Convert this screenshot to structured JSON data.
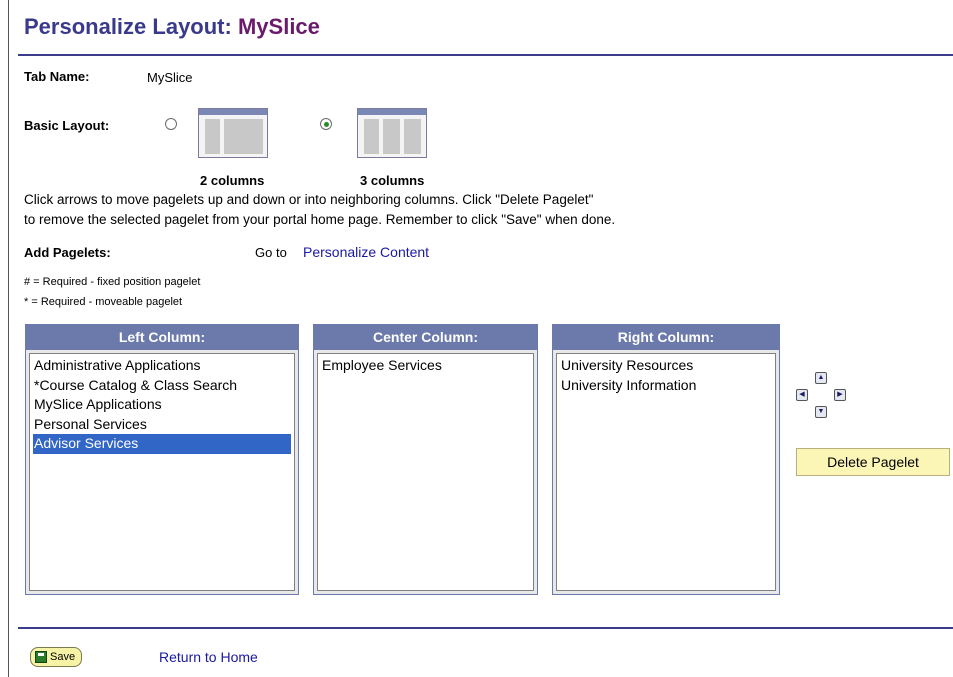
{
  "page": {
    "title_prefix": "Personalize Layout:",
    "title_tab": "MySlice"
  },
  "tab_name": {
    "label": "Tab Name:",
    "value": "MySlice"
  },
  "basic_layout": {
    "label": "Basic Layout:",
    "options": [
      {
        "label": "2 columns",
        "selected": false
      },
      {
        "label": "3 columns",
        "selected": true
      }
    ]
  },
  "instructions": {
    "line1": "Click arrows to move pagelets up and down or into neighboring columns. Click \"Delete Pagelet\"",
    "line2": "to remove the selected pagelet from your portal home page. Remember to click \"Save\" when done."
  },
  "add_pagelets": {
    "label": "Add Pagelets:",
    "goto": "Go to",
    "link": "Personalize Content"
  },
  "legend": {
    "fixed": "# = Required - fixed position pagelet",
    "moveable": "* = Required - moveable pagelet"
  },
  "columns": {
    "left": {
      "header": "Left Column:",
      "items": [
        "Administrative Applications",
        "*Course Catalog & Class Search",
        "MySlice Applications",
        "Personal Services",
        "Advisor Services"
      ],
      "selected_index": 4
    },
    "center": {
      "header": "Center Column:",
      "items": [
        "Employee Services"
      ]
    },
    "right": {
      "header": "Right Column:",
      "items": [
        "University Resources",
        "University Information"
      ]
    }
  },
  "arrows": {
    "up": "▲",
    "down": "▼",
    "left": "◀",
    "right": "▶"
  },
  "delete_button": "Delete Pagelet",
  "footer": {
    "save": "Save",
    "return_link": "Return to Home"
  },
  "colors": {
    "title": "#3a3a8c",
    "title_tab": "#6b1a6b",
    "column_header": "#6b79ab",
    "selection": "#3165c6",
    "delete_button_bg": "#fbf6b6"
  }
}
